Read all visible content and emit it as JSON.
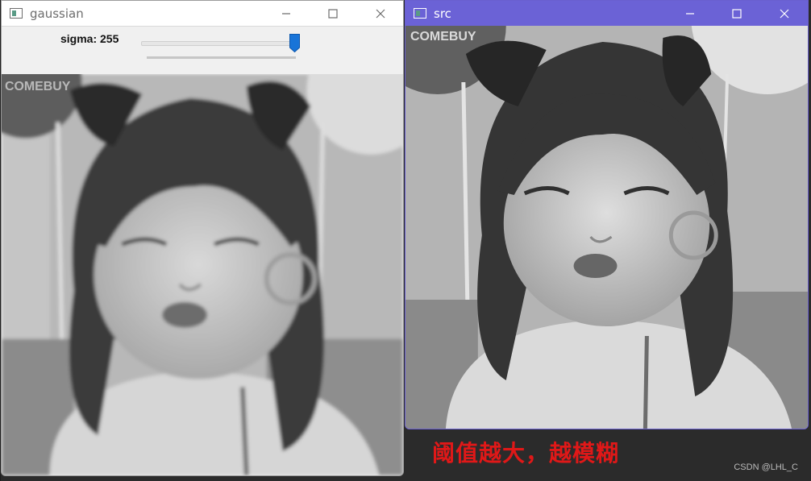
{
  "windows": {
    "gaussian": {
      "title": "gaussian"
    },
    "src": {
      "title": "src"
    }
  },
  "trackbar": {
    "label": "sigma: 255",
    "value": 255,
    "max": 255
  },
  "photo": {
    "balloon_text": "COMEBUY"
  },
  "caption": "阈值越大，越模糊",
  "watermark": "CSDN @LHL_C",
  "colors": {
    "active_titlebar": "#6b62d6",
    "slider_thumb": "#1874d8",
    "caption": "#e01818",
    "desktop": "#2b2b2b"
  },
  "icons": [
    "app-icon",
    "minimize-icon",
    "maximize-icon",
    "close-icon",
    "slider-thumb"
  ]
}
